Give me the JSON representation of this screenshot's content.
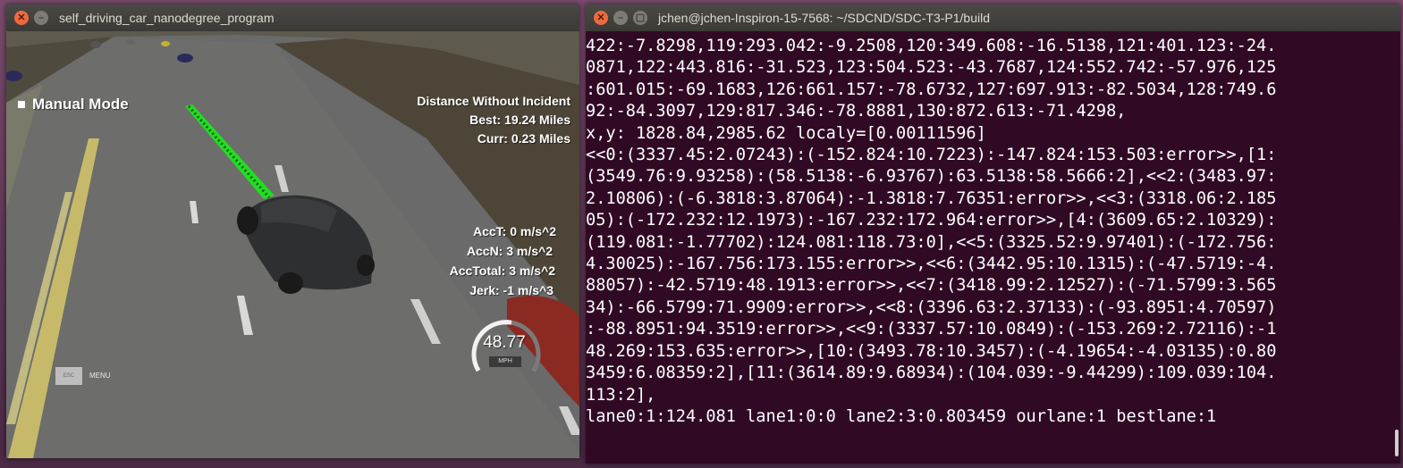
{
  "sim_window": {
    "title": "self_driving_car_nanodegree_program",
    "close_glyph": "✕",
    "minimize_glyph": "–"
  },
  "hud": {
    "mode_label": "Manual Mode",
    "distance_title": "Distance Without Incident",
    "best": "Best: 19.24 Miles",
    "curr": "Curr: 0.23 Miles",
    "acc_t": "AccT: 0 m/s^2",
    "acc_n": "AccN: 3 m/s^2",
    "acc_total": "AccTotal: 3 m/s^2",
    "jerk": "Jerk: -1 m/s^3",
    "speed": "48.77",
    "speed_unit": "MPH",
    "speed_level": 0.54,
    "esc_label": "ESC",
    "menu_label": "MENU"
  },
  "terminal_window": {
    "title": "jchen@jchen-Inspiron-15-7568: ~/SDCND/SDC-T3-P1/build",
    "close_glyph": "✕",
    "minimize_glyph": "–",
    "maximize_glyph": "▢",
    "lines": [
      "422:-7.8298,119:293.042:-9.2508,120:349.608:-16.5138,121:401.123:-24.",
      "0871,122:443.816:-31.523,123:504.523:-43.7687,124:552.742:-57.976,125",
      ":601.015:-69.1683,126:661.157:-78.6732,127:697.913:-82.5034,128:749.6",
      "92:-84.3097,129:817.346:-78.8881,130:872.613:-71.4298,",
      "x,y: 1828.84,2985.62 localy=[0.00111596]",
      "<<0:(3337.45:2.07243):(-152.824:10.7223):-147.824:153.503:error>>,[1:",
      "(3549.76:9.93258):(58.5138:-6.93767):63.5138:58.5666:2],<<2:(3483.97:",
      "2.10806):(-6.3818:3.87064):-1.3818:7.76351:error>>,<<3:(3318.06:2.185",
      "05):(-172.232:12.1973):-167.232:172.964:error>>,[4:(3609.65:2.10329):",
      "(119.081:-1.77702):124.081:118.73:0],<<5:(3325.52:9.97401):(-172.756:",
      "4.30025):-167.756:173.155:error>>,<<6:(3442.95:10.1315):(-47.5719:-4.",
      "88057):-42.5719:48.1913:error>>,<<7:(3418.99:2.12527):(-71.5799:3.565",
      "34):-66.5799:71.9909:error>>,<<8:(3396.63:2.37133):(-93.8951:4.70597)",
      ":-88.8951:94.3519:error>>,<<9:(3337.57:10.0849):(-153.269:2.72116):-1",
      "48.269:153.635:error>>,[10:(3493.78:10.3457):(-4.19654:-4.03135):0.80",
      "3459:6.08359:2],[11:(3614.89:9.68934):(104.039:-9.44299):109.039:104.",
      "113:2],",
      "lane0:1:124.081 lane1:0:0 lane2:3:0.803459 ourlane:1 bestlane:1"
    ]
  },
  "colors": {
    "terminal_bg": "#300a24",
    "titlebar": "#3b3a36",
    "close_btn": "#f0693d",
    "trajectory": "#22dd22"
  }
}
